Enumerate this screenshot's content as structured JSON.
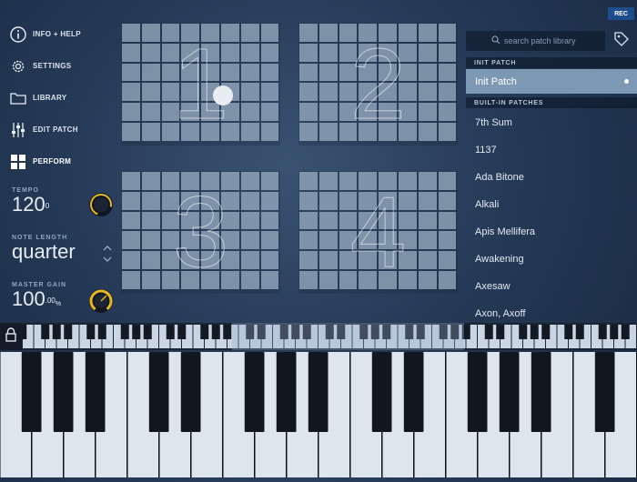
{
  "menu": [
    {
      "label": "INFO + HELP",
      "icon": "info-icon"
    },
    {
      "label": "SETTINGS",
      "icon": "gear-icon"
    },
    {
      "label": "LIBRARY",
      "icon": "folder-icon"
    },
    {
      "label": "EDIT PATCH",
      "icon": "sliders-icon"
    },
    {
      "label": "PERFORM",
      "icon": "grid-icon"
    }
  ],
  "tempo": {
    "caption": "TEMPO",
    "value": "120",
    "unit": "0"
  },
  "note_length": {
    "caption": "NOTE LENGTH",
    "value": "quarter"
  },
  "master_gain": {
    "caption": "MASTER GAIN",
    "value": "100",
    "frac": ".00",
    "unit": "%"
  },
  "pads": [
    "1",
    "2",
    "3",
    "4"
  ],
  "rec_label": "REC",
  "search": {
    "placeholder": "search patch library"
  },
  "init_section": "INIT PATCH",
  "selected_patch": "Init Patch",
  "builtin_section": "BUILT-IN PATCHES",
  "patches": [
    "7th Sum",
    "1137",
    "Ada Bitone",
    "Alkali",
    "Apis Mellifera",
    "Awakening",
    "Axesaw",
    "Axon, Axoff"
  ],
  "colors": {
    "accent": "#e8b820",
    "selected": "#7d98b4",
    "rec": "#1d4d8a"
  }
}
